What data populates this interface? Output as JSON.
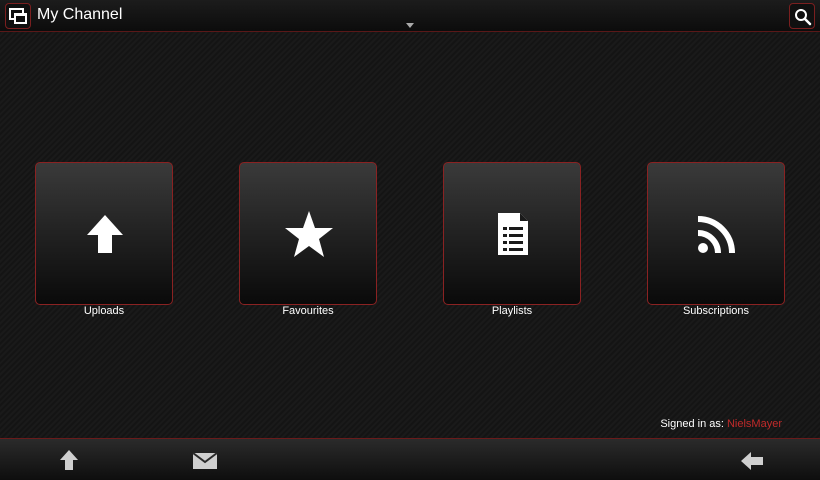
{
  "header": {
    "title": "My Channel",
    "menu_icon": "windows-icon",
    "search_icon": "search-icon"
  },
  "tiles": [
    {
      "label": "Uploads",
      "icon": "upload-arrow-icon"
    },
    {
      "label": "Favourites",
      "icon": "star-icon"
    },
    {
      "label": "Playlists",
      "icon": "document-list-icon"
    },
    {
      "label": "Subscriptions",
      "icon": "rss-icon"
    }
  ],
  "status": {
    "signed_in_prefix": "Signed in as: ",
    "username": "NielsMayer"
  },
  "bottom_bar": {
    "left_icons": [
      "upload-icon",
      "mail-icon"
    ],
    "right_icon": "back-arrow-icon"
  },
  "colors": {
    "accent": "#8a2222",
    "username": "#c02a2a",
    "background": "#141414"
  }
}
